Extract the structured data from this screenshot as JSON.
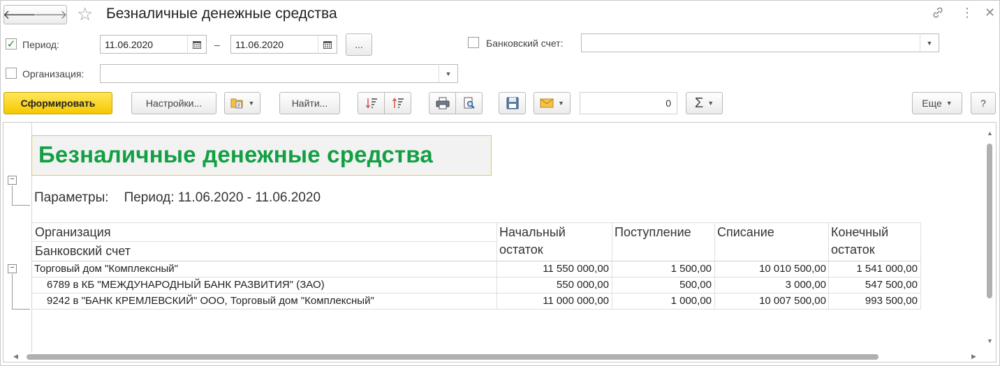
{
  "window": {
    "title": "Безналичные денежные средства",
    "back_glyph": "🡐",
    "forward_glyph": "🡒",
    "favorite_glyph": "☆",
    "link_glyph": "🔗",
    "menu_glyph": "⋮",
    "close_glyph": "✕"
  },
  "filters": {
    "period_label": "Период:",
    "period_checked": true,
    "date_from": "11.06.2020",
    "dash": "–",
    "date_to": "11.06.2020",
    "ellipsis_label": "...",
    "bank_account_label": "Банковский счет:",
    "bank_account_checked": false,
    "bank_account_value": "",
    "organization_label": "Организация:",
    "organization_checked": false,
    "organization_value": ""
  },
  "toolbar": {
    "generate_label": "Сформировать",
    "settings_label": "Настройки...",
    "find_label": "Найти...",
    "sum_value": "0",
    "sigma_glyph": "Σ",
    "more_label": "Еще",
    "help_label": "?"
  },
  "icons": {
    "variants": "report-variants-icon",
    "sort_down": "sort-descending-icon",
    "sort_up": "sort-ascending-icon",
    "print": "printer-icon",
    "preview": "print-preview-icon",
    "save": "floppy-disk-icon",
    "mail": "envelope-icon",
    "calendar": "calendar-icon"
  },
  "colors": {
    "primary_button": "#f5c800",
    "report_title": "#139f43",
    "title_border": "#e6c84a",
    "checkmark": "#1a8f2a"
  },
  "report": {
    "title": "Безналичные денежные средства",
    "params_label": "Параметры:",
    "params_value": "Период: 11.06.2020 - 11.06.2020",
    "columns": {
      "org": "Организация",
      "account": "Банковский счет",
      "opening_1": "Начальный",
      "opening_2": "остаток",
      "incoming": "Поступление",
      "outgoing": "Списание",
      "closing_1": "Конечный",
      "closing_2": "остаток"
    },
    "rows": [
      {
        "name": "Торговый дом \"Комплексный\"",
        "opening": "11 550 000,00",
        "incoming": "1 500,00",
        "outgoing": "10 010 500,00",
        "closing": "1 541 000,00"
      },
      {
        "name": "6789 в КБ \"МЕЖДУНАРОДНЫЙ БАНК РАЗВИТИЯ\" (ЗАО)",
        "opening": "550 000,00",
        "incoming": "500,00",
        "outgoing": "3 000,00",
        "closing": "547 500,00"
      },
      {
        "name": "9242 в \"БАНК КРЕМЛЕВСКИЙ\" ООО, Торговый дом \"Комплексный\"",
        "opening": "11 000 000,00",
        "incoming": "1 000,00",
        "outgoing": "10 007 500,00",
        "closing": "993 500,00"
      }
    ]
  }
}
